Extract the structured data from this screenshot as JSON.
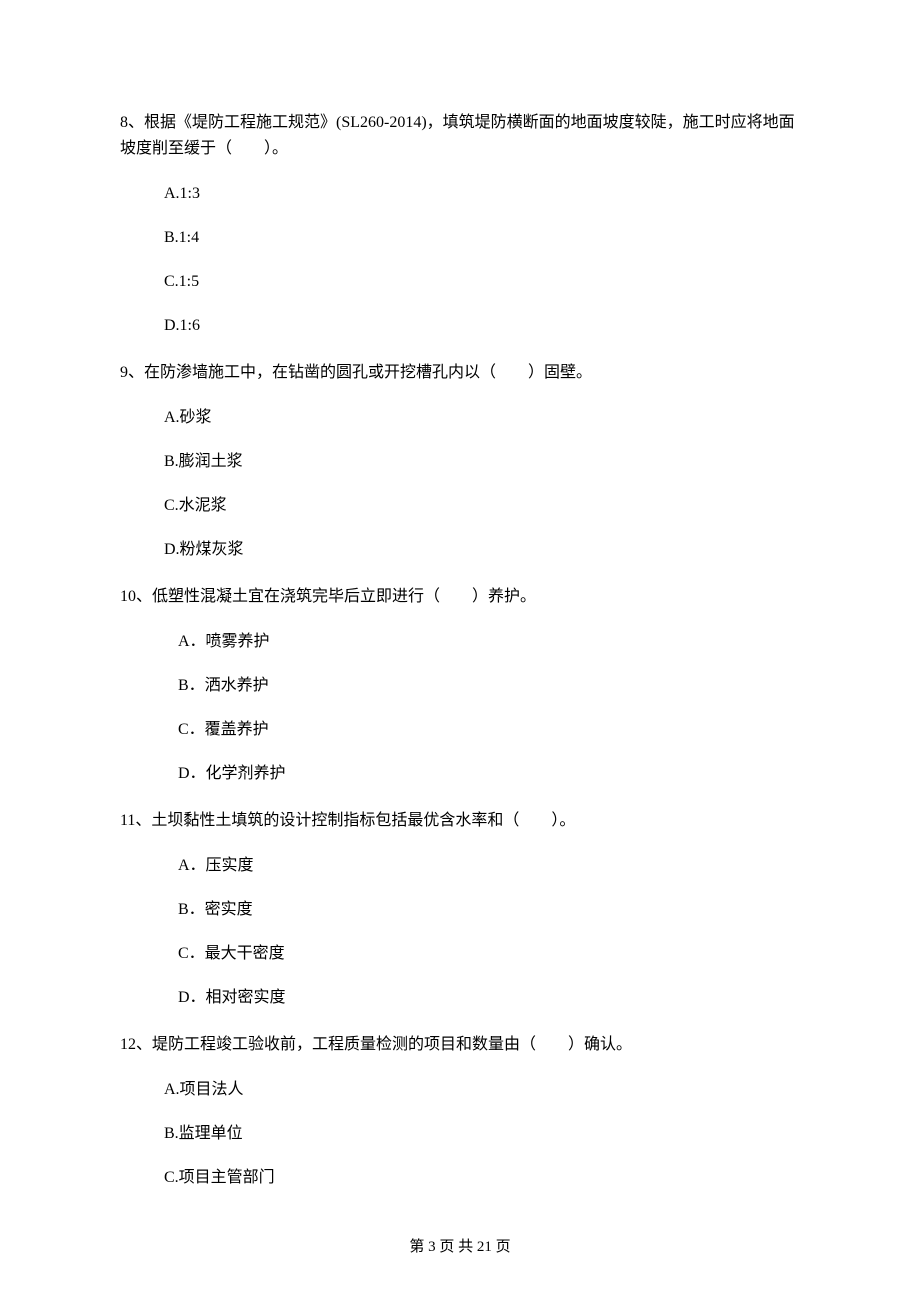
{
  "questions": [
    {
      "number": "8、",
      "text": "根据《堤防工程施工规范》(SL260-2014)，填筑堤防横断面的地面坡度较陡，施工时应将地面坡度削至缓于（　　）。",
      "options": [
        "A.1:3",
        "B.1:4",
        "C.1:5",
        "D.1:6"
      ],
      "indent": "opt"
    },
    {
      "number": "9、",
      "text": "在防渗墙施工中，在钻凿的圆孔或开挖槽孔内以（　　）固壁。",
      "options": [
        "A.砂浆",
        "B.膨润土浆",
        "C.水泥浆",
        "D.粉煤灰浆"
      ],
      "indent": "opt"
    },
    {
      "number": "10、",
      "text": "低塑性混凝土宜在浇筑完毕后立即进行（　　）养护。",
      "options": [
        "A．喷雾养护",
        "B．洒水养护",
        "C．覆盖养护",
        "D．化学剂养护"
      ],
      "indent": "opt2"
    },
    {
      "number": "11、",
      "text": "土坝黏性土填筑的设计控制指标包括最优含水率和（　　）。",
      "options": [
        "A．压实度",
        "B．密实度",
        "C．最大干密度",
        "D．相对密实度"
      ],
      "indent": "opt2"
    },
    {
      "number": "12、",
      "text": "堤防工程竣工验收前，工程质量检测的项目和数量由（　　）确认。",
      "options": [
        "A.项目法人",
        "B.监理单位",
        "C.项目主管部门"
      ],
      "indent": "opt"
    }
  ],
  "footer": "第 3 页 共 21 页"
}
